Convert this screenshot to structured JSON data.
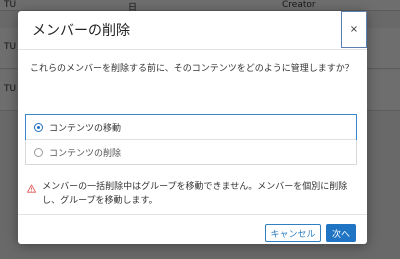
{
  "background": {
    "rows": [
      {
        "cells": [
          "TU",
          "日",
          "Creator"
        ]
      },
      {
        "cells": [
          "TU",
          "",
          ""
        ]
      },
      {
        "cells": [
          "TU",
          "",
          ""
        ]
      }
    ]
  },
  "dialog": {
    "title": "メンバーの削除",
    "close_label": "×",
    "question": "これらのメンバーを削除する前に、そのコンテンツをどのように管理しますか？",
    "options": [
      {
        "label": "コンテンツの移動",
        "selected": true
      },
      {
        "label": "コンテンツの削除",
        "selected": false
      }
    ],
    "warning": "メンバーの一括削除中はグループを移動できません。メンバーを個別に削除し、グループを移動します。",
    "buttons": {
      "cancel": "キャンセル",
      "next": "次へ"
    }
  },
  "colors": {
    "accent": "#1f74c4",
    "warning": "#d9534f"
  },
  "icons": {
    "close": "close-icon",
    "warning": "warning-triangle-icon"
  }
}
